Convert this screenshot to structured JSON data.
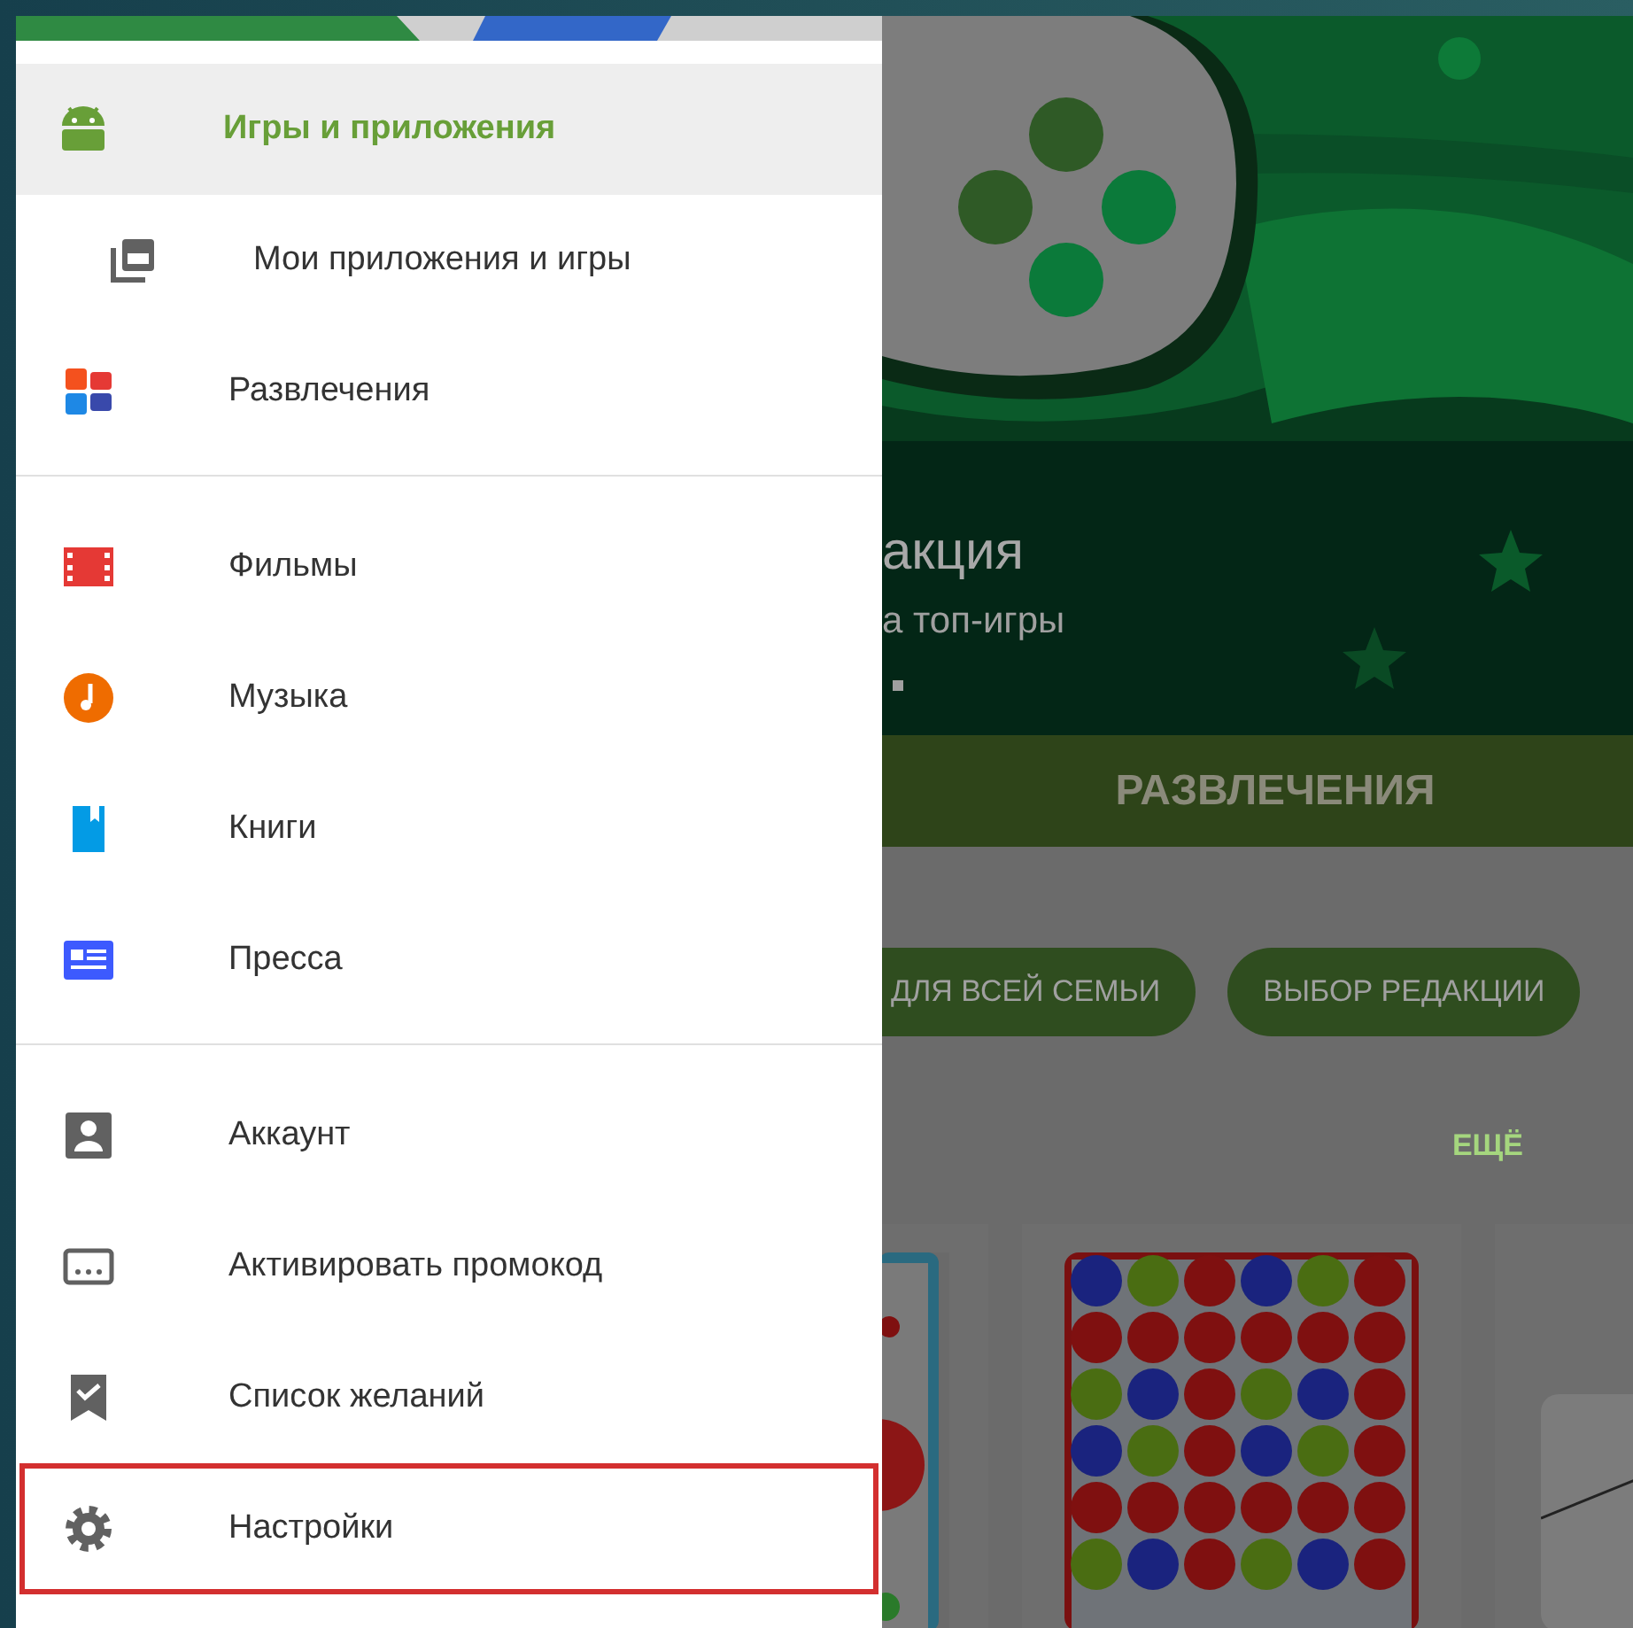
{
  "drawer": {
    "sections": [
      {
        "items": [
          {
            "label": "Игры и приложения",
            "selected": true,
            "highlighted": false,
            "children": [
              {
                "label": "Мои приложения и игры",
                "selected": false,
                "highlighted": false
              }
            ]
          },
          {
            "label": "Развлечения",
            "selected": false,
            "highlighted": false
          }
        ]
      },
      {
        "items": [
          {
            "label": "Фильмы",
            "selected": false,
            "highlighted": false
          },
          {
            "label": "Музыка",
            "selected": false,
            "highlighted": false
          },
          {
            "label": "Книги",
            "selected": false,
            "highlighted": false
          },
          {
            "label": "Пресса",
            "selected": false,
            "highlighted": false
          }
        ]
      },
      {
        "items": [
          {
            "label": "Аккаунт",
            "selected": false,
            "highlighted": false
          },
          {
            "label": "Активировать промокод",
            "selected": false,
            "highlighted": false
          },
          {
            "label": "Список желаний",
            "selected": false,
            "highlighted": false
          },
          {
            "label": "Настройки",
            "selected": false,
            "highlighted": true
          }
        ]
      }
    ]
  },
  "content": {
    "banner": {
      "title": "акция",
      "subtitle": "а топ-игры"
    },
    "tab": "РАЗВЛЕЧЕНИЯ",
    "chips": [
      "ДЛЯ ВСЕЙ СЕМЬИ",
      "ВЫБОР РЕДАКЦИИ"
    ],
    "more_link": "ЕЩЁ"
  }
}
